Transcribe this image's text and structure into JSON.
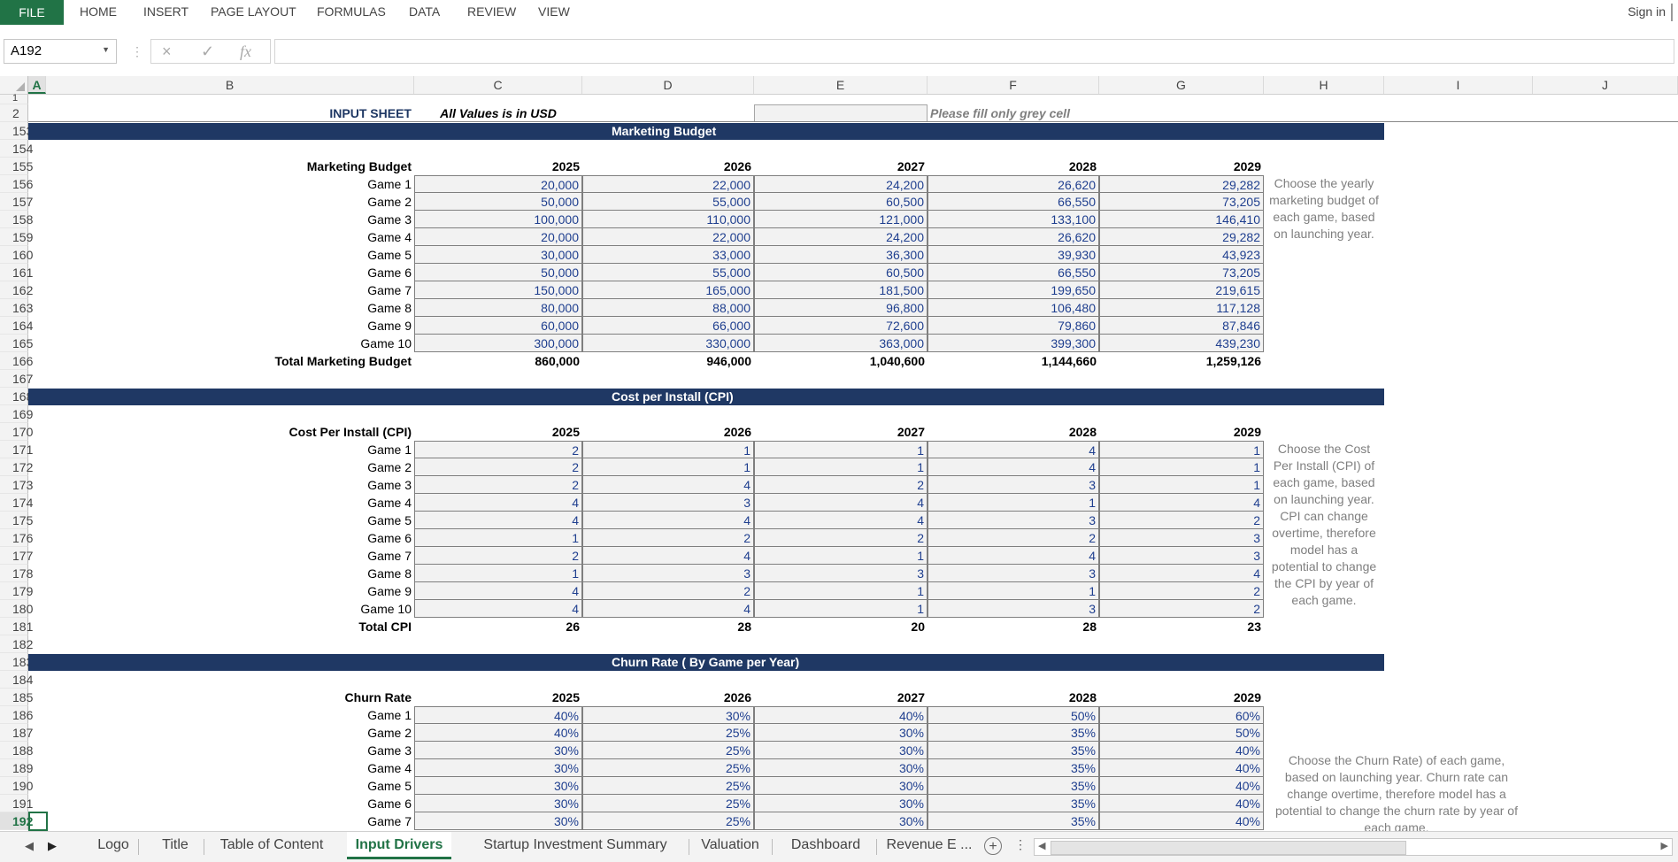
{
  "ribbon": {
    "file": "FILE",
    "tabs": [
      "HOME",
      "INSERT",
      "PAGE LAYOUT",
      "FORMULAS",
      "DATA",
      "REVIEW",
      "VIEW"
    ],
    "sign_in": "Sign in"
  },
  "formula_bar": {
    "name_box": "A192",
    "cancel_icon": "×",
    "enter_icon": "✓",
    "fx": "fx",
    "value": ""
  },
  "columns": [
    "A",
    "B",
    "C",
    "D",
    "E",
    "F",
    "G",
    "H",
    "I",
    "J"
  ],
  "sheet": {
    "row1": "1",
    "row2": "2",
    "input_sheet_label": "INPUT SHEET",
    "values_note": "All Values is in USD",
    "fill_note": "Please fill only grey cell",
    "years": [
      "2025",
      "2026",
      "2027",
      "2028",
      "2029"
    ],
    "marketing": {
      "banner": "Marketing Budget",
      "header": "Marketing Budget",
      "rows": [
        {
          "r": "156",
          "label": "Game 1",
          "v": [
            "20,000",
            "22,000",
            "24,200",
            "26,620",
            "29,282"
          ]
        },
        {
          "r": "157",
          "label": "Game 2",
          "v": [
            "50,000",
            "55,000",
            "60,500",
            "66,550",
            "73,205"
          ]
        },
        {
          "r": "158",
          "label": "Game 3",
          "v": [
            "100,000",
            "110,000",
            "121,000",
            "133,100",
            "146,410"
          ]
        },
        {
          "r": "159",
          "label": "Game 4",
          "v": [
            "20,000",
            "22,000",
            "24,200",
            "26,620",
            "29,282"
          ]
        },
        {
          "r": "160",
          "label": "Game 5",
          "v": [
            "30,000",
            "33,000",
            "36,300",
            "39,930",
            "43,923"
          ]
        },
        {
          "r": "161",
          "label": "Game 6",
          "v": [
            "50,000",
            "55,000",
            "60,500",
            "66,550",
            "73,205"
          ]
        },
        {
          "r": "162",
          "label": "Game 7",
          "v": [
            "150,000",
            "165,000",
            "181,500",
            "199,650",
            "219,615"
          ]
        },
        {
          "r": "163",
          "label": "Game 8",
          "v": [
            "80,000",
            "88,000",
            "96,800",
            "106,480",
            "117,128"
          ]
        },
        {
          "r": "164",
          "label": "Game 9",
          "v": [
            "60,000",
            "66,000",
            "72,600",
            "79,860",
            "87,846"
          ]
        },
        {
          "r": "165",
          "label": "Game 10",
          "v": [
            "300,000",
            "330,000",
            "363,000",
            "399,300",
            "439,230"
          ]
        }
      ],
      "total_label": "Total Marketing Budget",
      "total": [
        "860,000",
        "946,000",
        "1,040,600",
        "1,144,660",
        "1,259,126"
      ],
      "note_lines": [
        "Choose the yearly",
        "marketing budget of",
        "each game, based",
        "on launching year."
      ]
    },
    "cpi": {
      "banner": "Cost per Install (CPI)",
      "header": "Cost Per Install (CPI)",
      "rows": [
        {
          "r": "171",
          "label": "Game 1",
          "v": [
            "2",
            "1",
            "1",
            "4",
            "1"
          ]
        },
        {
          "r": "172",
          "label": "Game 2",
          "v": [
            "2",
            "1",
            "1",
            "4",
            "1"
          ]
        },
        {
          "r": "173",
          "label": "Game 3",
          "v": [
            "2",
            "4",
            "2",
            "3",
            "1"
          ]
        },
        {
          "r": "174",
          "label": "Game 4",
          "v": [
            "4",
            "3",
            "4",
            "1",
            "4"
          ]
        },
        {
          "r": "175",
          "label": "Game 5",
          "v": [
            "4",
            "4",
            "4",
            "3",
            "2"
          ]
        },
        {
          "r": "176",
          "label": "Game 6",
          "v": [
            "1",
            "2",
            "2",
            "2",
            "3"
          ]
        },
        {
          "r": "177",
          "label": "Game 7",
          "v": [
            "2",
            "4",
            "1",
            "4",
            "3"
          ]
        },
        {
          "r": "178",
          "label": "Game 8",
          "v": [
            "1",
            "3",
            "3",
            "3",
            "4"
          ]
        },
        {
          "r": "179",
          "label": "Game 9",
          "v": [
            "4",
            "2",
            "1",
            "1",
            "2"
          ]
        },
        {
          "r": "180",
          "label": "Game 10",
          "v": [
            "4",
            "4",
            "1",
            "3",
            "2"
          ]
        }
      ],
      "total_label": "Total CPI",
      "total": [
        "26",
        "28",
        "20",
        "28",
        "23"
      ],
      "note_lines": [
        "Choose the Cost",
        "Per Install (CPI) of",
        "each game, based",
        "on launching year.",
        "CPI can change",
        "overtime, therefore",
        "model has a",
        "potential to change",
        "the CPI by year of",
        "each game."
      ]
    },
    "churn": {
      "banner": "Churn Rate ( By Game per Year)",
      "header": "Churn Rate",
      "rows": [
        {
          "r": "186",
          "label": "Game 1",
          "v": [
            "40%",
            "30%",
            "40%",
            "50%",
            "60%"
          ]
        },
        {
          "r": "187",
          "label": "Game 2",
          "v": [
            "40%",
            "25%",
            "30%",
            "35%",
            "50%"
          ]
        },
        {
          "r": "188",
          "label": "Game 3",
          "v": [
            "30%",
            "25%",
            "30%",
            "35%",
            "40%"
          ]
        },
        {
          "r": "189",
          "label": "Game 4",
          "v": [
            "30%",
            "25%",
            "30%",
            "35%",
            "40%"
          ]
        },
        {
          "r": "190",
          "label": "Game 5",
          "v": [
            "30%",
            "25%",
            "30%",
            "35%",
            "40%"
          ]
        },
        {
          "r": "191",
          "label": "Game 6",
          "v": [
            "30%",
            "25%",
            "30%",
            "35%",
            "40%"
          ]
        },
        {
          "r": "192",
          "label": "Game 7",
          "v": [
            "30%",
            "25%",
            "30%",
            "35%",
            "40%"
          ]
        }
      ],
      "note_lines": [
        "Choose the Churn Rate) of each game,",
        "based on launching year. Churn rate can",
        "change overtime, therefore model has a",
        "potential to change the churn rate by year of",
        "each game."
      ]
    }
  },
  "sheet_tabs": {
    "items": [
      "Logo",
      "Title",
      "Table of Content",
      "Input Drivers",
      "Startup Investment Summary",
      "Valuation",
      "Dashboard",
      "Revenue E ..."
    ],
    "active": "Input Drivers",
    "add_icon": "+",
    "menu_icon": "⋮"
  }
}
